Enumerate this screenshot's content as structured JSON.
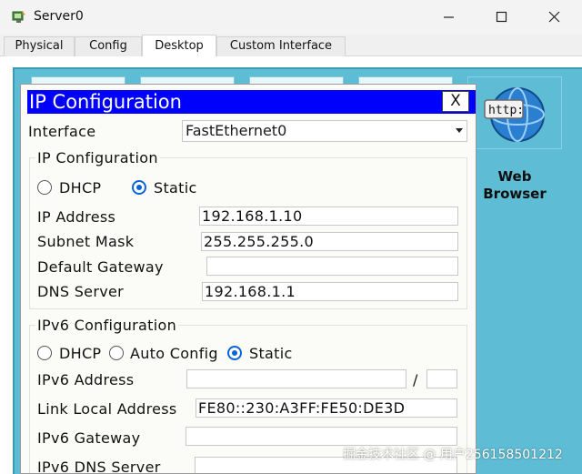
{
  "window": {
    "title": "Server0"
  },
  "tabs": [
    {
      "label": "Physical",
      "active": false
    },
    {
      "label": "Config",
      "active": false
    },
    {
      "label": "Desktop",
      "active": true
    },
    {
      "label": "Custom Interface",
      "active": false
    }
  ],
  "desktop": {
    "background_color": "#5ebdd5",
    "web_browser": {
      "label": "Web Browser",
      "icon_text": "http:",
      "icon": "web-browser-icon"
    }
  },
  "dialog": {
    "title": "IP Configuration",
    "close_label": "X",
    "title_bar_color": "#0000ff",
    "interface": {
      "label": "Interface",
      "value": "FastEthernet0"
    },
    "ipv4": {
      "group_title": "IP Configuration",
      "dhcp_label": "DHCP",
      "static_label": "Static",
      "mode": "Static",
      "ip_address": {
        "label": "IP Address",
        "value": "192.168.1.10"
      },
      "subnet_mask": {
        "label": "Subnet Mask",
        "value": "255.255.255.0"
      },
      "default_gateway": {
        "label": "Default Gateway",
        "value": ""
      },
      "dns_server": {
        "label": "DNS Server",
        "value": "192.168.1.1"
      }
    },
    "ipv6": {
      "group_title": "IPv6 Configuration",
      "dhcp_label": "DHCP",
      "auto_config_label": "Auto Config",
      "static_label": "Static",
      "mode": "Static",
      "ipv6_address": {
        "label": "IPv6 Address",
        "value": "",
        "prefix_separator": "/",
        "prefix": ""
      },
      "link_local_address": {
        "label": "Link Local Address",
        "value": "FE80::230:A3FF:FE50:DE3D"
      },
      "ipv6_gateway": {
        "label": "IPv6 Gateway",
        "value": ""
      },
      "ipv6_dns_server": {
        "label": "IPv6 DNS Server",
        "value": ""
      }
    }
  },
  "watermark": {
    "text": "掘金技术社区 @ 用户2561585012​12"
  }
}
